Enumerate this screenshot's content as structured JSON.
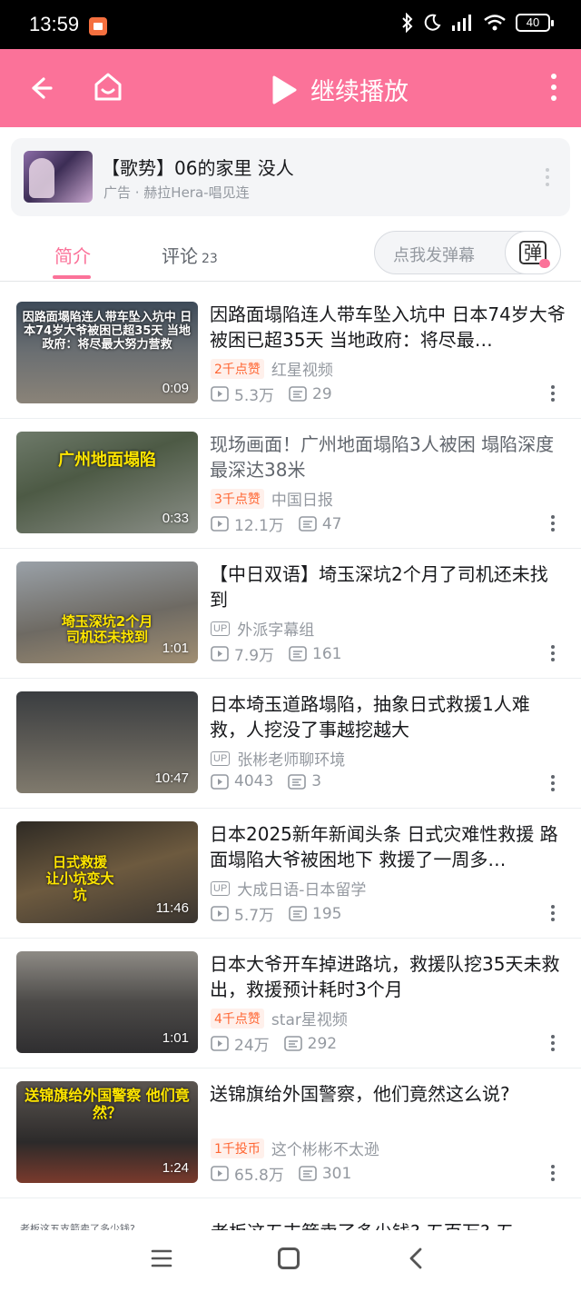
{
  "status_bar": {
    "time": "13:59",
    "battery": "40"
  },
  "nav": {
    "play_label": "继续播放"
  },
  "ad": {
    "title": "【歌势】06的家里 没人",
    "subtitle": "广告 · 赫拉Hera-唱见连"
  },
  "tabs": {
    "intro": "简介",
    "comments": "评论",
    "comments_count": "23",
    "danmaku_placeholder": "点我发弹幕",
    "danmaku_glyph": "弹"
  },
  "videos": [
    {
      "thumb_text": "因路面塌陷连人带车坠入坑中 日本74岁大爷被困已超35天 当地政府：将尽最大努力营救",
      "duration": "0:09",
      "title": "因路面塌陷连人带车坠入坑中 日本74岁大爷被困已超35天 当地政府：将尽最…",
      "badge": "2千点赞",
      "author": "红星视频",
      "views": "5.3万",
      "comments": "29"
    },
    {
      "thumb_text": "广州地面塌陷",
      "duration": "0:33",
      "title": "现场画面！广州地面塌陷3人被困 塌陷深度最深达38米",
      "badge": "3千点赞",
      "author": "中国日报",
      "views": "12.1万",
      "comments": "47"
    },
    {
      "thumb_text": "埼玉深坑2个月 司机还未找到",
      "duration": "1:01",
      "title": "【中日双语】埼玉深坑2个月了司机还未找到",
      "badge": "",
      "up_tag": "UP",
      "author": "外派字幕组",
      "views": "7.9万",
      "comments": "161"
    },
    {
      "thumb_text": "",
      "duration": "10:47",
      "title": "日本埼玉道路塌陷，抽象日式救援1人难救，人挖没了事越挖越大",
      "badge": "",
      "up_tag": "UP",
      "author": "张彬老师聊环境",
      "views": "4043",
      "comments": "3"
    },
    {
      "thumb_text": "日式救援 让小坑变大坑",
      "duration": "11:46",
      "title": "日本2025新年新闻头条 日式灾难性救援 路面塌陷大爷被困地下 救援了一周多…",
      "badge": "",
      "up_tag": "UP",
      "author": "大成日语-日本留学",
      "views": "5.7万",
      "comments": "195"
    },
    {
      "thumb_text": "",
      "duration": "1:01",
      "title": "日本大爷开车掉进路坑，救援队挖35天未救出，救援预计耗时3个月",
      "badge": "4千点赞",
      "author": "star星视频",
      "views": "24万",
      "comments": "292"
    },
    {
      "thumb_text": "送锦旗给外国警察 他们竟然？",
      "duration": "1:24",
      "title": "送锦旗给外国警察，他们竟然这么说?",
      "badge": "1千投币",
      "author": "这个彬彬不太逊",
      "views": "65.8万",
      "comments": "301"
    }
  ],
  "partial_row": {
    "thumb_text": "老板这五支箭卖了多少钱?",
    "title": "老板这五支箭卖了多少钱? 五百万? 五"
  }
}
